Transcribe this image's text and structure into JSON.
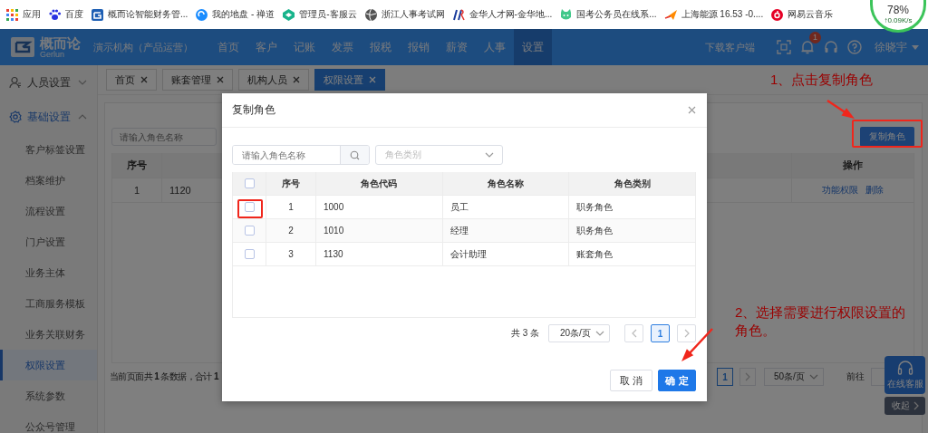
{
  "bookmarks": [
    {
      "label": "应用"
    },
    {
      "label": "百度"
    },
    {
      "label": "概而论智能财务管..."
    },
    {
      "label": "我的地盘 - 禅道"
    },
    {
      "label": "管理员-客服云"
    },
    {
      "label": "浙江人事考试网"
    },
    {
      "label": "金华人才网-金华地..."
    },
    {
      "label": "国考公务员在线系..."
    },
    {
      "label": "上海能源 16.53 -0...."
    },
    {
      "label": "网易云音乐"
    }
  ],
  "network_widget": {
    "percent": "78%",
    "speed": "↑0.09K/s"
  },
  "header": {
    "brand": "概而论",
    "brand_sub": "Gerlun",
    "org": "演示机构（产品运营）",
    "nav": [
      {
        "label": "首页",
        "selected": false
      },
      {
        "label": "客户",
        "selected": false
      },
      {
        "label": "记账",
        "selected": false
      },
      {
        "label": "发票",
        "selected": false
      },
      {
        "label": "报税",
        "selected": false
      },
      {
        "label": "报销",
        "selected": false
      },
      {
        "label": "薪资",
        "selected": false
      },
      {
        "label": "人事",
        "selected": false
      },
      {
        "label": "设置",
        "selected": true
      }
    ],
    "download": "下载客户端",
    "notifications": "1",
    "user": "徐晓宇"
  },
  "sidebar": {
    "items": [
      {
        "label": "人员设置",
        "expanded": false
      },
      {
        "label": "基础设置",
        "expanded": true,
        "children": [
          {
            "label": "客户标签设置",
            "selected": false
          },
          {
            "label": "档案维护",
            "selected": false
          },
          {
            "label": "流程设置",
            "selected": false
          },
          {
            "label": "门户设置",
            "selected": false
          },
          {
            "label": "业务主体",
            "selected": false
          },
          {
            "label": "工商服务模板",
            "selected": false
          },
          {
            "label": "业务关联财务",
            "selected": false
          },
          {
            "label": "权限设置",
            "selected": true
          },
          {
            "label": "系统参数",
            "selected": false
          },
          {
            "label": "公众号管理",
            "selected": false
          }
        ]
      }
    ]
  },
  "tabs": [
    {
      "label": "首页",
      "selected": false
    },
    {
      "label": "账套管理",
      "selected": false
    },
    {
      "label": "机构人员",
      "selected": false
    },
    {
      "label": "权限设置",
      "selected": true
    }
  ],
  "page": {
    "search_placeholder": "请输入角色名称",
    "copy_button": "复制角色",
    "table": {
      "columns": [
        {
          "label": "序号"
        },
        {
          "label": "操作"
        }
      ],
      "rows": [
        {
          "index": "1",
          "code": "1120",
          "actions": [
            "功能权限",
            "删除"
          ]
        }
      ]
    },
    "summary": "当前页面共 **1** 条数据，合计 **1**",
    "pagination": {
      "pages": [
        {
          "label": "1",
          "selected": true
        }
      ],
      "page_size": "50条/页",
      "goto": "前往"
    }
  },
  "support": {
    "label": "在线客服",
    "collapse": "收起"
  },
  "modal": {
    "title": "复制角色",
    "search_placeholder": "请输入角色名称",
    "type_placeholder": "角色类别",
    "all_checked": false,
    "columns": [
      {
        "label": "序号"
      },
      {
        "label": "角色代码"
      },
      {
        "label": "角色名称"
      },
      {
        "label": "角色类别"
      }
    ],
    "rows": [
      {
        "index": "1",
        "code": "1000",
        "name": "员工",
        "type": "职务角色",
        "checked": false
      },
      {
        "index": "2",
        "code": "1010",
        "name": "经理",
        "type": "职务角色",
        "checked": false
      },
      {
        "index": "3",
        "code": "1130",
        "name": "会计助理",
        "type": "账套角色",
        "checked": false
      }
    ],
    "total": "共 3 条",
    "page_size": "20条/页",
    "pages": [
      {
        "label": "1",
        "selected": true
      }
    ],
    "buttons": [
      {
        "label": "取 消",
        "kind": "secondary"
      },
      {
        "label": "确 定",
        "kind": "primary"
      }
    ]
  },
  "annotations": [
    {
      "text": "1、点击复制角色"
    },
    {
      "text": "2、选择需要进行权限设置的角色。"
    }
  ]
}
